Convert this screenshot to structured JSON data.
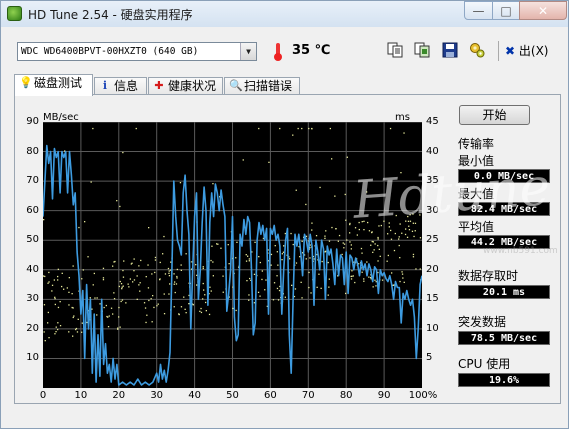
{
  "window": {
    "title": "HD Tune 2.54 - 硬盘实用程序",
    "min_glyph": "—",
    "max_glyph": "□",
    "close_glyph": "✕"
  },
  "toolbar": {
    "drive": "WDC WD6400BPVT-00HXZT0 (640 GB)",
    "temperature": "35 ℃",
    "exit_label": "出(X)",
    "icons": [
      "copy-text-icon",
      "copy-screen-icon",
      "save-icon",
      "options-icon"
    ]
  },
  "tabs": [
    {
      "label": "磁盘测试",
      "icon": "lightbulb-icon",
      "active": true
    },
    {
      "label": "信息",
      "icon": "info-icon",
      "active": false
    },
    {
      "label": "健康状况",
      "icon": "health-cross-icon",
      "active": false
    },
    {
      "label": "扫描错误",
      "icon": "magnifier-icon",
      "active": false
    }
  ],
  "side": {
    "start_label": "开始",
    "transfer_heading": "传输率",
    "min_label": "最小值",
    "min_value": "0.0 MB/sec",
    "max_label": "最大值",
    "max_value": "82.4 MB/sec",
    "avg_label": "平均值",
    "avg_value": "44.2 MB/sec",
    "access_label": "数据存取时",
    "access_value": "20.1 ms",
    "burst_label": "突发数据",
    "burst_value": "78.5 MB/sec",
    "cpu_label": "CPU 使用",
    "cpu_value": "19.6%"
  },
  "watermark": {
    "main": "Hdtune",
    "sub": "www.nb591.com"
  },
  "colors": {
    "plot_bg": "#000000",
    "grid": "#5a5a5a",
    "line": "#3d9be0",
    "dots": "#e6e89a"
  },
  "chart_data": {
    "type": "line",
    "ylabel_left": "MB/sec",
    "ylabel_right": "ms",
    "x_ticks": [
      "0",
      "10",
      "20",
      "30",
      "40",
      "50",
      "60",
      "70",
      "80",
      "90",
      "100%"
    ],
    "y_left_ticks": [
      10,
      20,
      30,
      40,
      50,
      60,
      70,
      80,
      90
    ],
    "y_right_ticks": [
      5,
      10,
      15,
      20,
      25,
      30,
      35,
      40,
      45
    ],
    "xlim": [
      0,
      100
    ],
    "ylim_left": [
      0,
      90
    ],
    "ylim_right": [
      0,
      45
    ],
    "grid": true,
    "series": [
      {
        "values": [
          [
            0,
            58
          ],
          [
            0.5,
            70
          ],
          [
            1,
            82
          ],
          [
            1.5,
            76
          ],
          [
            2,
            80
          ],
          [
            2.5,
            64
          ],
          [
            3,
            81
          ],
          [
            3.5,
            78
          ],
          [
            4,
            80
          ],
          [
            4.5,
            66
          ],
          [
            5,
            80
          ],
          [
            5.5,
            78
          ],
          [
            6,
            80
          ],
          [
            6.5,
            66
          ],
          [
            7,
            80
          ],
          [
            7.5,
            72
          ],
          [
            8,
            62
          ],
          [
            8.5,
            66
          ],
          [
            9,
            46
          ],
          [
            9.5,
            38
          ],
          [
            10,
            25
          ],
          [
            10.5,
            33
          ],
          [
            11,
            10
          ],
          [
            11.5,
            35
          ],
          [
            12,
            20
          ],
          [
            12.5,
            30
          ],
          [
            13,
            5
          ],
          [
            13.5,
            25
          ],
          [
            14,
            2
          ],
          [
            14.5,
            18
          ],
          [
            15,
            4
          ],
          [
            15.5,
            30
          ],
          [
            16,
            8
          ],
          [
            16.5,
            15
          ],
          [
            17,
            5
          ],
          [
            17.5,
            8
          ],
          [
            18,
            2
          ],
          [
            18.5,
            10
          ],
          [
            19,
            3
          ],
          [
            19.5,
            8
          ],
          [
            20,
            1
          ],
          [
            21,
            2
          ],
          [
            22,
            1
          ],
          [
            23,
            2
          ],
          [
            24,
            1
          ],
          [
            25,
            3
          ],
          [
            26,
            1
          ],
          [
            27,
            2
          ],
          [
            28,
            1
          ],
          [
            29,
            2
          ],
          [
            30,
            5
          ],
          [
            30.5,
            2
          ],
          [
            31,
            8
          ],
          [
            31.5,
            3
          ],
          [
            32,
            6
          ],
          [
            32.5,
            2
          ],
          [
            33,
            6
          ],
          [
            33.5,
            12
          ],
          [
            34,
            40
          ],
          [
            34.5,
            70
          ],
          [
            35,
            58
          ],
          [
            35.5,
            50
          ],
          [
            36,
            48
          ],
          [
            36.5,
            45
          ],
          [
            37,
            66
          ],
          [
            37.5,
            72
          ],
          [
            38,
            60
          ],
          [
            38.5,
            52
          ],
          [
            39,
            20
          ],
          [
            39.5,
            40
          ],
          [
            40,
            58
          ],
          [
            40.5,
            66
          ],
          [
            41,
            30
          ],
          [
            41.5,
            40
          ],
          [
            42,
            56
          ],
          [
            42.5,
            68
          ],
          [
            43,
            60
          ],
          [
            43.5,
            28
          ],
          [
            44,
            56
          ],
          [
            44.5,
            66
          ],
          [
            45,
            58
          ],
          [
            45.5,
            69
          ],
          [
            46,
            66
          ],
          [
            46.5,
            60
          ],
          [
            47,
            67
          ],
          [
            47.5,
            62
          ],
          [
            48,
            58
          ],
          [
            48.5,
            26
          ],
          [
            49,
            32
          ],
          [
            49.5,
            40
          ],
          [
            50,
            58
          ],
          [
            50.5,
            24
          ],
          [
            51,
            16
          ],
          [
            51.5,
            18
          ],
          [
            52,
            52
          ],
          [
            52.5,
            48
          ],
          [
            53,
            57
          ],
          [
            53.5,
            52
          ],
          [
            54,
            58
          ],
          [
            54.5,
            56
          ],
          [
            55,
            40
          ],
          [
            55.5,
            18
          ],
          [
            56,
            22
          ],
          [
            56.5,
            50
          ],
          [
            57,
            56
          ],
          [
            57.5,
            52
          ],
          [
            58,
            55
          ],
          [
            58.5,
            50
          ],
          [
            59,
            54
          ],
          [
            59.5,
            25
          ],
          [
            60,
            54
          ],
          [
            60.5,
            52
          ],
          [
            61,
            55
          ],
          [
            61.5,
            50
          ],
          [
            62,
            52
          ],
          [
            62.5,
            48
          ],
          [
            63,
            25
          ],
          [
            63.5,
            40
          ],
          [
            64,
            50
          ],
          [
            64.5,
            54
          ],
          [
            65,
            18
          ],
          [
            65.5,
            5
          ],
          [
            66,
            30
          ],
          [
            66.5,
            52
          ],
          [
            67,
            48
          ],
          [
            67.5,
            52
          ],
          [
            68,
            46
          ],
          [
            68.5,
            38
          ],
          [
            69,
            52
          ],
          [
            69.5,
            50
          ],
          [
            70,
            46
          ],
          [
            70.5,
            52
          ],
          [
            71,
            48
          ],
          [
            71.5,
            28
          ],
          [
            72,
            50
          ],
          [
            72.5,
            46
          ],
          [
            73,
            40
          ],
          [
            73.5,
            50
          ],
          [
            74,
            47
          ],
          [
            74.5,
            30
          ],
          [
            75,
            48
          ],
          [
            75.5,
            45
          ],
          [
            76,
            47
          ],
          [
            76.5,
            42
          ],
          [
            77,
            35
          ],
          [
            77.5,
            47
          ],
          [
            78,
            38
          ],
          [
            78.5,
            45
          ],
          [
            79,
            44
          ],
          [
            79.5,
            35
          ],
          [
            80,
            46
          ],
          [
            80.5,
            32
          ],
          [
            81,
            45
          ],
          [
            81.5,
            44
          ],
          [
            82,
            40
          ],
          [
            82.5,
            44
          ],
          [
            83,
            42
          ],
          [
            83.5,
            38
          ],
          [
            84,
            43
          ],
          [
            84.5,
            40
          ],
          [
            85,
            42
          ],
          [
            85.5,
            38
          ],
          [
            86,
            42
          ],
          [
            86.5,
            40
          ],
          [
            87,
            36
          ],
          [
            87.5,
            41
          ],
          [
            88,
            40
          ],
          [
            88.5,
            32
          ],
          [
            89,
            40
          ],
          [
            89.5,
            38
          ],
          [
            90,
            39
          ],
          [
            90.5,
            37
          ],
          [
            91,
            36
          ],
          [
            91.5,
            38
          ],
          [
            92,
            35
          ],
          [
            92.5,
            30
          ],
          [
            93,
            36
          ],
          [
            93.5,
            34
          ],
          [
            94,
            34
          ],
          [
            94.5,
            22
          ],
          [
            95,
            32
          ],
          [
            95.5,
            30
          ],
          [
            96,
            33
          ],
          [
            96.5,
            30
          ],
          [
            97,
            28
          ],
          [
            97.5,
            30
          ],
          [
            98,
            24
          ],
          [
            98.5,
            10
          ],
          [
            99,
            20
          ],
          [
            99.5,
            35
          ],
          [
            100,
            38
          ]
        ]
      }
    ]
  }
}
